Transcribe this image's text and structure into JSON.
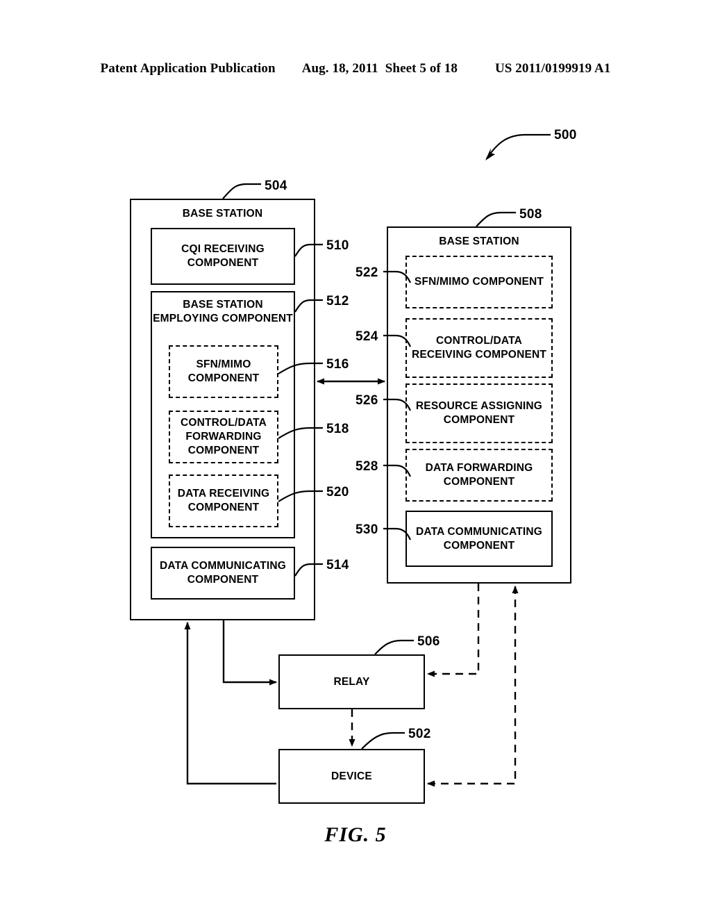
{
  "header": {
    "publication": "Patent Application Publication",
    "date": "Aug. 18, 2011",
    "sheet": "Sheet 5 of 18",
    "number": "US 2011/0199919 A1"
  },
  "figure": {
    "caption": "FIG. 5",
    "system_ref": "500"
  },
  "left_base_station": {
    "ref": "504",
    "title": "BASE STATION",
    "components": [
      {
        "ref": "510",
        "label": "CQI RECEIVING COMPONENT",
        "style": "solid"
      },
      {
        "ref": "512",
        "label": "BASE STATION EMPLOYING COMPONENT",
        "style": "solid"
      },
      {
        "ref": "516",
        "label": "SFN/MIMO COMPONENT",
        "style": "dashed"
      },
      {
        "ref": "518",
        "label": "CONTROL/DATA FORWARDING COMPONENT",
        "style": "dashed"
      },
      {
        "ref": "520",
        "label": "DATA RECEIVING COMPONENT",
        "style": "dashed"
      },
      {
        "ref": "514",
        "label": "DATA COMMUNICATING COMPONENT",
        "style": "solid"
      }
    ]
  },
  "right_base_station": {
    "ref": "508",
    "title": "BASE STATION",
    "components": [
      {
        "ref": "522",
        "label": "SFN/MIMO COMPONENT",
        "style": "dashed"
      },
      {
        "ref": "524",
        "label": "CONTROL/DATA RECEIVING COMPONENT",
        "style": "dashed"
      },
      {
        "ref": "526",
        "label": "RESOURCE ASSIGNING COMPONENT",
        "style": "dashed"
      },
      {
        "ref": "528",
        "label": "DATA FORWARDING COMPONENT",
        "style": "dashed"
      },
      {
        "ref": "530",
        "label": "DATA COMMUNICATING COMPONENT",
        "style": "solid"
      }
    ]
  },
  "relay": {
    "ref": "506",
    "label": "RELAY"
  },
  "device": {
    "ref": "502",
    "label": "DEVICE"
  }
}
